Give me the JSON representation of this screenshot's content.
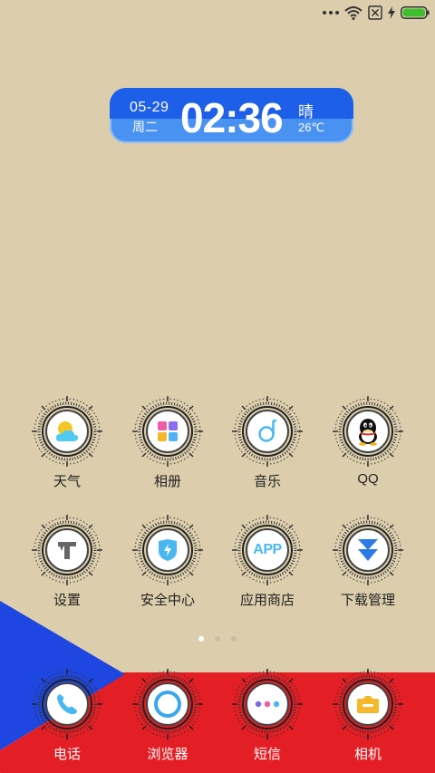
{
  "status_bar": {
    "icons": [
      "more-dots-icon",
      "wifi-icon",
      "no-sim-icon",
      "charging-icon",
      "battery-icon"
    ],
    "battery_color": "#3fbf2f"
  },
  "clock_widget": {
    "date": "05-29",
    "weekday": "周二",
    "time": "02:36",
    "weather": "晴",
    "temperature": "26℃"
  },
  "apps": [
    {
      "label": "天气",
      "icon": "weather-icon"
    },
    {
      "label": "相册",
      "icon": "gallery-icon"
    },
    {
      "label": "音乐",
      "icon": "music-icon"
    },
    {
      "label": "QQ",
      "icon": "qq-icon"
    },
    {
      "label": "设置",
      "icon": "settings-icon"
    },
    {
      "label": "安全中心",
      "icon": "security-icon"
    },
    {
      "label": "应用商店",
      "icon": "app-store-icon",
      "icon_text": "APP"
    },
    {
      "label": "下载管理",
      "icon": "download-icon"
    }
  ],
  "page_indicator": {
    "count": 3,
    "active": 1
  },
  "dock": [
    {
      "label": "电话",
      "icon": "phone-icon"
    },
    {
      "label": "浏览器",
      "icon": "browser-icon"
    },
    {
      "label": "短信",
      "icon": "messages-icon"
    },
    {
      "label": "相机",
      "icon": "camera-icon"
    }
  ],
  "colors": {
    "background": "#dcceac",
    "dock_red": "#e31e24",
    "flag_blue": "#1e46e0",
    "clock_blue": "#1d5fe8"
  }
}
